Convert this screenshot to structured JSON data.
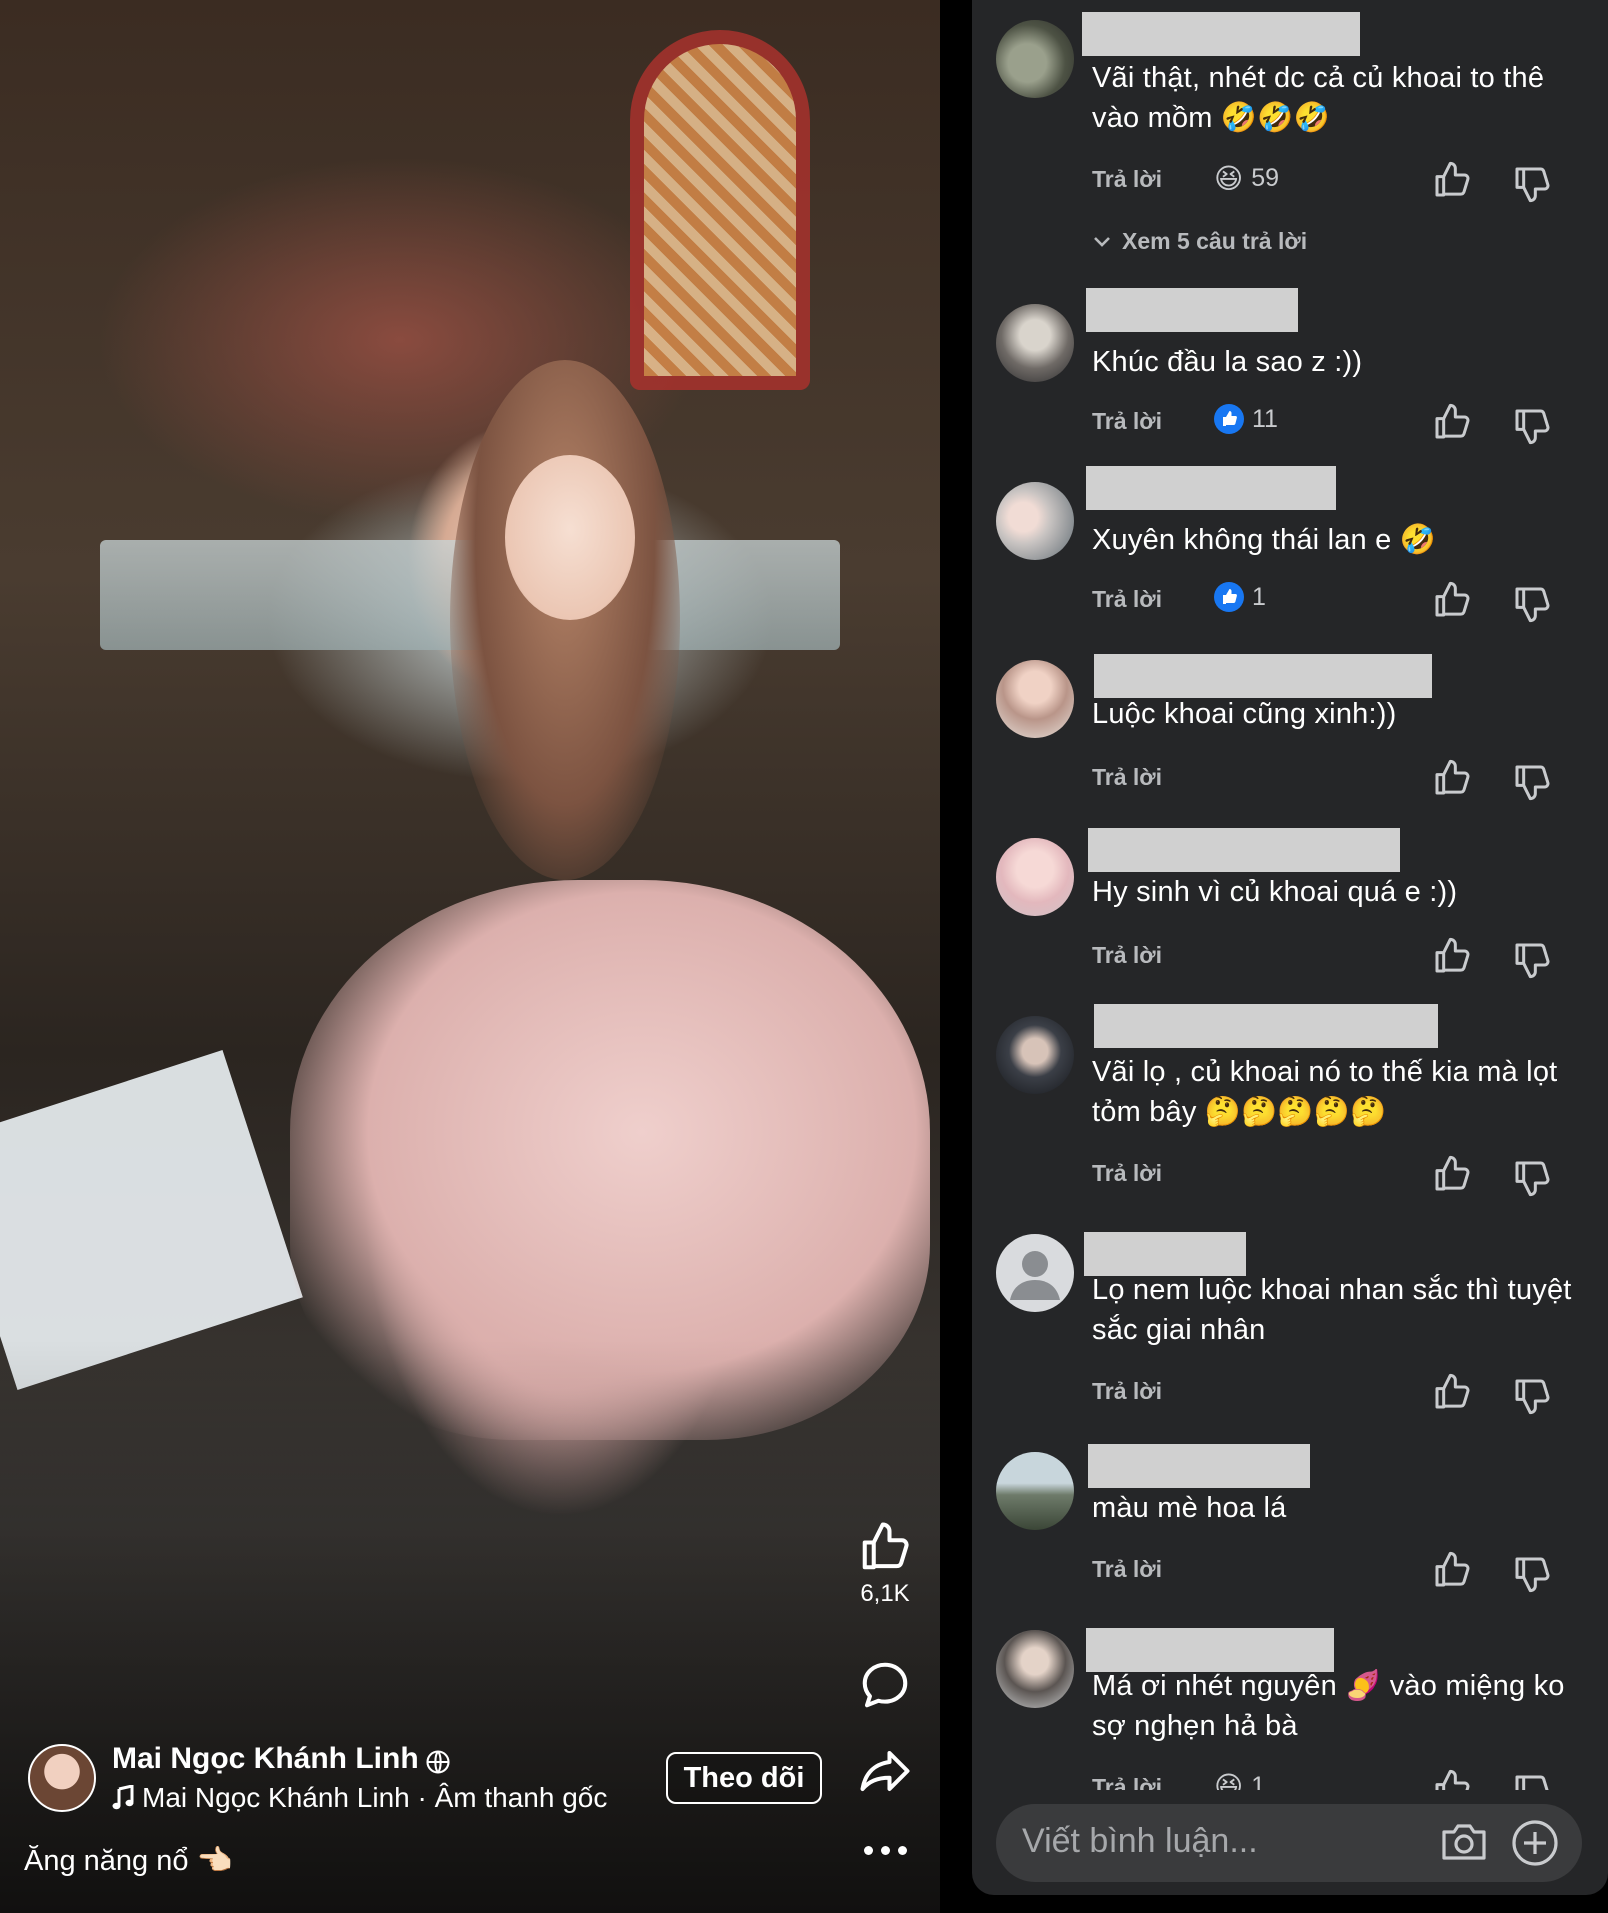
{
  "video": {
    "creator_name": "Mai Ngọc Khánh Linh",
    "music": "Mai Ngọc Khánh Linh · Âm thanh gốc",
    "follow_label": "Theo dõi",
    "caption": "Ăng năng nổ 👈🏻",
    "like_count": "6,1K"
  },
  "comments_panel": {
    "reply_label": "Trả lời",
    "view_replies_label": "Xem 5 câu trả lời",
    "comments": [
      {
        "text": "Vãi thật, nhét dc cả củ khoai to thê vào mồm 🤣🤣🤣",
        "reaction_icon": "haha-emoji",
        "reaction_emoji": "😆",
        "reaction_count": "59"
      },
      {
        "text": "Khúc đầu la sao z :))",
        "reaction_icon": "like-badge-icon",
        "reaction_count": "11"
      },
      {
        "text": "Xuyên không thái lan e 🤣",
        "reaction_icon": "like-badge-icon",
        "reaction_count": "1"
      },
      {
        "text": "Luộc khoai cũng xinh:))"
      },
      {
        "text": "Hy sinh vì củ khoai quá e :))"
      },
      {
        "text": "Vãi lọ , củ khoai nó to thế kia mà lọt tỏm bây 🤔🤔🤔🤔🤔"
      },
      {
        "text": "Lọ nem luộc khoai nhan sắc thì tuyệt sắc giai nhân"
      },
      {
        "text": "màu mè hoa lá"
      },
      {
        "text": "Má ơi nhét nguyên 🍠 vào miệng ko sợ nghẹn hả bà",
        "reaction_icon": "haha-emoji",
        "reaction_emoji": "😆",
        "reaction_count": "1"
      }
    ],
    "composer_placeholder": "Viết bình luận..."
  },
  "colors": {
    "panel_bg": "#252628",
    "like_badge_blue": "#1877f2",
    "redaction_gray": "#d0d0d0"
  }
}
